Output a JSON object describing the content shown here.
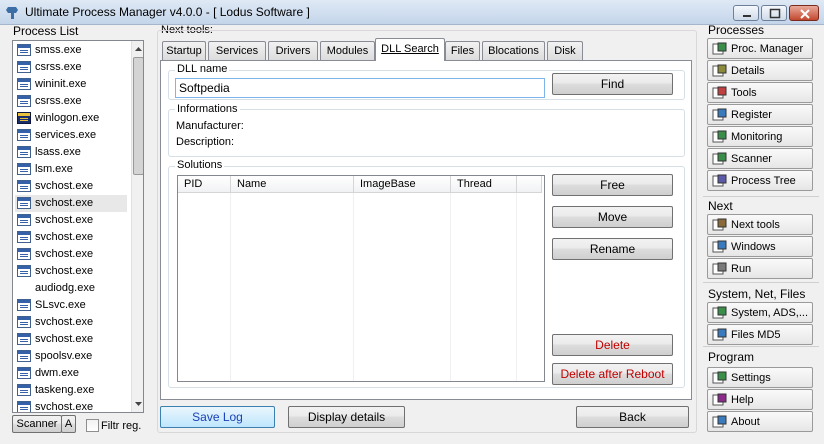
{
  "window": {
    "title": "Ultimate Process Manager v4.0.0 - [ Lodus Software ]"
  },
  "process_list": {
    "label": "Process List",
    "items": [
      {
        "name": "smss.exe",
        "icon": "window-icon"
      },
      {
        "name": "csrss.exe",
        "icon": "window-icon"
      },
      {
        "name": "wininit.exe",
        "icon": "window-icon"
      },
      {
        "name": "csrss.exe",
        "icon": "window-icon"
      },
      {
        "name": "winlogon.exe",
        "icon": "winlogon-icon"
      },
      {
        "name": "services.exe",
        "icon": "window-icon"
      },
      {
        "name": "lsass.exe",
        "icon": "window-icon"
      },
      {
        "name": "lsm.exe",
        "icon": "window-icon"
      },
      {
        "name": "svchost.exe",
        "icon": "window-icon"
      },
      {
        "name": "svchost.exe",
        "icon": "window-icon"
      },
      {
        "name": "svchost.exe",
        "icon": "window-icon"
      },
      {
        "name": "svchost.exe",
        "icon": "window-icon"
      },
      {
        "name": "svchost.exe",
        "icon": "window-icon"
      },
      {
        "name": "svchost.exe",
        "icon": "window-icon"
      },
      {
        "name": "audiodg.exe",
        "icon": "none"
      },
      {
        "name": "SLsvc.exe",
        "icon": "window-icon"
      },
      {
        "name": "svchost.exe",
        "icon": "window-icon"
      },
      {
        "name": "svchost.exe",
        "icon": "window-icon"
      },
      {
        "name": "spoolsv.exe",
        "icon": "window-icon"
      },
      {
        "name": "dwm.exe",
        "icon": "window-icon"
      },
      {
        "name": "taskeng.exe",
        "icon": "window-icon"
      },
      {
        "name": "svchost.exe",
        "icon": "window-icon"
      }
    ],
    "selected_index": 9,
    "scanner_button": "Scanner",
    "a_button": "A",
    "filter_checkbox_label": "Filtr reg."
  },
  "next_tools": {
    "label": "Next tools:",
    "tabs": [
      "Startup",
      "Services",
      "Drivers",
      "Modules",
      "DLL Search",
      "Files",
      "Blocations",
      "Disk"
    ],
    "active_tab": "DLL Search"
  },
  "dll_search": {
    "dll_name_label": "DLL name",
    "dll_name_value": "Softpedia",
    "find_button": "Find",
    "informations_label": "Informations",
    "manufacturer_label": "Manufacturer:",
    "description_label": "Description:",
    "solutions_label": "Solutions",
    "columns": [
      "PID",
      "Name",
      "ImageBase",
      "Thread"
    ],
    "free_button": "Free",
    "move_button": "Move",
    "rename_button": "Rename",
    "delete_button": "Delete",
    "delete_reboot_button": "Delete after Reboot"
  },
  "bottom": {
    "save_log": "Save Log",
    "display_details": "Display details",
    "back": "Back"
  },
  "sidebar": {
    "processes_header": "Processes",
    "processes": [
      "Proc. Manager",
      "Details",
      "Tools",
      "Register",
      "Monitoring",
      "Scanner",
      "Process Tree"
    ],
    "next_header": "Next",
    "next": [
      "Next tools",
      "Windows",
      "Run"
    ],
    "system_header": "System, Net, Files",
    "system": [
      "System, ADS,...",
      "Files MD5"
    ],
    "program_header": "Program",
    "program": [
      "Settings",
      "Help",
      "About"
    ]
  },
  "colors": {
    "accent_blue": "#1a3fb8",
    "danger_red": "#c00000"
  }
}
